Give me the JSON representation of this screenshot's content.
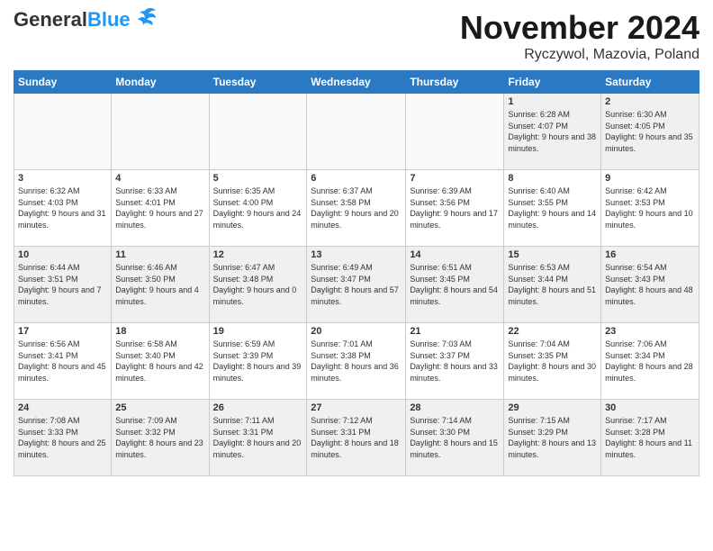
{
  "header": {
    "logo_line1": "General",
    "logo_line2": "Blue",
    "month_title": "November 2024",
    "location": "Ryczywol, Mazovia, Poland"
  },
  "weekdays": [
    "Sunday",
    "Monday",
    "Tuesday",
    "Wednesday",
    "Thursday",
    "Friday",
    "Saturday"
  ],
  "weeks": [
    [
      {
        "day": "",
        "info": ""
      },
      {
        "day": "",
        "info": ""
      },
      {
        "day": "",
        "info": ""
      },
      {
        "day": "",
        "info": ""
      },
      {
        "day": "",
        "info": ""
      },
      {
        "day": "1",
        "info": "Sunrise: 6:28 AM\nSunset: 4:07 PM\nDaylight: 9 hours and 38 minutes."
      },
      {
        "day": "2",
        "info": "Sunrise: 6:30 AM\nSunset: 4:05 PM\nDaylight: 9 hours and 35 minutes."
      }
    ],
    [
      {
        "day": "3",
        "info": "Sunrise: 6:32 AM\nSunset: 4:03 PM\nDaylight: 9 hours and 31 minutes."
      },
      {
        "day": "4",
        "info": "Sunrise: 6:33 AM\nSunset: 4:01 PM\nDaylight: 9 hours and 27 minutes."
      },
      {
        "day": "5",
        "info": "Sunrise: 6:35 AM\nSunset: 4:00 PM\nDaylight: 9 hours and 24 minutes."
      },
      {
        "day": "6",
        "info": "Sunrise: 6:37 AM\nSunset: 3:58 PM\nDaylight: 9 hours and 20 minutes."
      },
      {
        "day": "7",
        "info": "Sunrise: 6:39 AM\nSunset: 3:56 PM\nDaylight: 9 hours and 17 minutes."
      },
      {
        "day": "8",
        "info": "Sunrise: 6:40 AM\nSunset: 3:55 PM\nDaylight: 9 hours and 14 minutes."
      },
      {
        "day": "9",
        "info": "Sunrise: 6:42 AM\nSunset: 3:53 PM\nDaylight: 9 hours and 10 minutes."
      }
    ],
    [
      {
        "day": "10",
        "info": "Sunrise: 6:44 AM\nSunset: 3:51 PM\nDaylight: 9 hours and 7 minutes."
      },
      {
        "day": "11",
        "info": "Sunrise: 6:46 AM\nSunset: 3:50 PM\nDaylight: 9 hours and 4 minutes."
      },
      {
        "day": "12",
        "info": "Sunrise: 6:47 AM\nSunset: 3:48 PM\nDaylight: 9 hours and 0 minutes."
      },
      {
        "day": "13",
        "info": "Sunrise: 6:49 AM\nSunset: 3:47 PM\nDaylight: 8 hours and 57 minutes."
      },
      {
        "day": "14",
        "info": "Sunrise: 6:51 AM\nSunset: 3:45 PM\nDaylight: 8 hours and 54 minutes."
      },
      {
        "day": "15",
        "info": "Sunrise: 6:53 AM\nSunset: 3:44 PM\nDaylight: 8 hours and 51 minutes."
      },
      {
        "day": "16",
        "info": "Sunrise: 6:54 AM\nSunset: 3:43 PM\nDaylight: 8 hours and 48 minutes."
      }
    ],
    [
      {
        "day": "17",
        "info": "Sunrise: 6:56 AM\nSunset: 3:41 PM\nDaylight: 8 hours and 45 minutes."
      },
      {
        "day": "18",
        "info": "Sunrise: 6:58 AM\nSunset: 3:40 PM\nDaylight: 8 hours and 42 minutes."
      },
      {
        "day": "19",
        "info": "Sunrise: 6:59 AM\nSunset: 3:39 PM\nDaylight: 8 hours and 39 minutes."
      },
      {
        "day": "20",
        "info": "Sunrise: 7:01 AM\nSunset: 3:38 PM\nDaylight: 8 hours and 36 minutes."
      },
      {
        "day": "21",
        "info": "Sunrise: 7:03 AM\nSunset: 3:37 PM\nDaylight: 8 hours and 33 minutes."
      },
      {
        "day": "22",
        "info": "Sunrise: 7:04 AM\nSunset: 3:35 PM\nDaylight: 8 hours and 30 minutes."
      },
      {
        "day": "23",
        "info": "Sunrise: 7:06 AM\nSunset: 3:34 PM\nDaylight: 8 hours and 28 minutes."
      }
    ],
    [
      {
        "day": "24",
        "info": "Sunrise: 7:08 AM\nSunset: 3:33 PM\nDaylight: 8 hours and 25 minutes."
      },
      {
        "day": "25",
        "info": "Sunrise: 7:09 AM\nSunset: 3:32 PM\nDaylight: 8 hours and 23 minutes."
      },
      {
        "day": "26",
        "info": "Sunrise: 7:11 AM\nSunset: 3:31 PM\nDaylight: 8 hours and 20 minutes."
      },
      {
        "day": "27",
        "info": "Sunrise: 7:12 AM\nSunset: 3:31 PM\nDaylight: 8 hours and 18 minutes."
      },
      {
        "day": "28",
        "info": "Sunrise: 7:14 AM\nSunset: 3:30 PM\nDaylight: 8 hours and 15 minutes."
      },
      {
        "day": "29",
        "info": "Sunrise: 7:15 AM\nSunset: 3:29 PM\nDaylight: 8 hours and 13 minutes."
      },
      {
        "day": "30",
        "info": "Sunrise: 7:17 AM\nSunset: 3:28 PM\nDaylight: 8 hours and 11 minutes."
      }
    ]
  ]
}
